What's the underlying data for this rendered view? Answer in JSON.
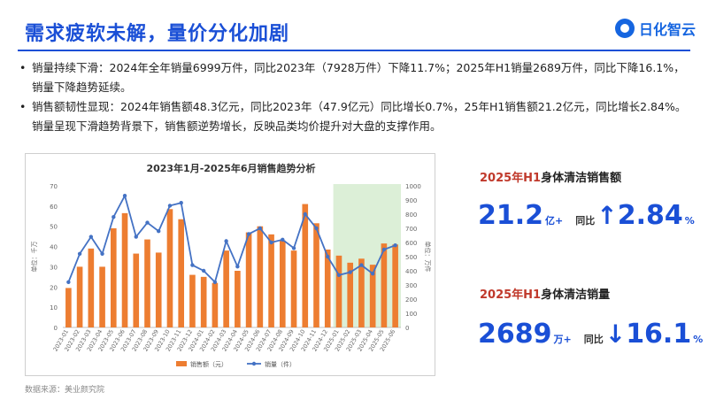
{
  "page": {
    "title": "需求疲软未解，量价分化加剧",
    "logo": "日化智云",
    "bullets": [
      "销量持续下滑：2024年全年销量6999万件，同比2023年（7928万件）下降11.7%；2025年H1销量2689万件，同比下降16.1%，销量下降趋势延续。",
      "销售额韧性显现：2024年销售额48.3亿元，同比2023年（47.9亿元）同比增长0.7%，25年H1销售额21.2亿元，同比增长2.84%。销量呈现下滑趋势背景下，销售额逆势增长，反映品类均价提升对大盘的支撑作用。"
    ],
    "source": "数据来源：美业颜究院"
  },
  "kpis": [
    {
      "prefix": "2025年H1",
      "label": "身体清洁销售额",
      "value": "21.2",
      "unit": "亿+",
      "yoy_label": "同比",
      "arrow": "↑",
      "pct": "2.84",
      "pct_sign": "%"
    },
    {
      "prefix": "2025年H1",
      "label": "身体清洁销量",
      "value": "2689",
      "unit": "万+",
      "yoy_label": "同比",
      "arrow": "↓",
      "pct": "16.1",
      "pct_sign": "%"
    }
  ],
  "chart_data": {
    "type": "bar",
    "title": "2023年1月-2025年6月销售趋势分析",
    "y_left_label": "单位：千万",
    "y_right_label": "单位：万件",
    "y_left_lim": [
      0,
      70
    ],
    "y_left_ticks": [
      0,
      10,
      20,
      30,
      40,
      50,
      60,
      70
    ],
    "y_right_lim": [
      0,
      1000
    ],
    "y_right_ticks": [
      0,
      100,
      200,
      300,
      400,
      500,
      600,
      700,
      800,
      900,
      1000
    ],
    "legend_position": "bottom",
    "highlight": {
      "from": "2025-01",
      "to": "2025-06",
      "color": "#d6ecd0"
    },
    "categories": [
      "2023-01",
      "2023-02",
      "2023-03",
      "2023-04",
      "2023-05",
      "2023-06",
      "2023-07",
      "2023-08",
      "2023-09",
      "2023-10",
      "2023-11",
      "2023-12",
      "2024-01",
      "2024-02",
      "2024-03",
      "2024-04",
      "2024-05",
      "2024-06",
      "2024-07",
      "2024-08",
      "2024-09",
      "2024-10",
      "2024-11",
      "2024-12",
      "2025-01",
      "2025-02",
      "2025-03",
      "2025-04",
      "2025-05",
      "2025-06"
    ],
    "series": [
      {
        "name": "销售额（元）",
        "kind": "bar",
        "axis": "left",
        "color": "#ed7d31",
        "values": [
          19.5,
          30,
          39,
          30,
          49,
          56.5,
          36.5,
          43.5,
          37,
          58.5,
          53.5,
          26,
          25,
          22,
          38,
          28,
          47,
          50,
          46,
          43,
          38,
          61,
          51.5,
          38.5,
          35.5,
          32,
          34,
          31,
          41.5,
          41
        ]
      },
      {
        "name": "销量（件）",
        "kind": "line",
        "axis": "right",
        "color": "#4472c4",
        "values": [
          320,
          520,
          640,
          520,
          780,
          930,
          640,
          740,
          680,
          860,
          880,
          440,
          400,
          320,
          610,
          430,
          660,
          700,
          600,
          620,
          560,
          800,
          700,
          500,
          370,
          390,
          440,
          380,
          550,
          580
        ]
      }
    ]
  }
}
